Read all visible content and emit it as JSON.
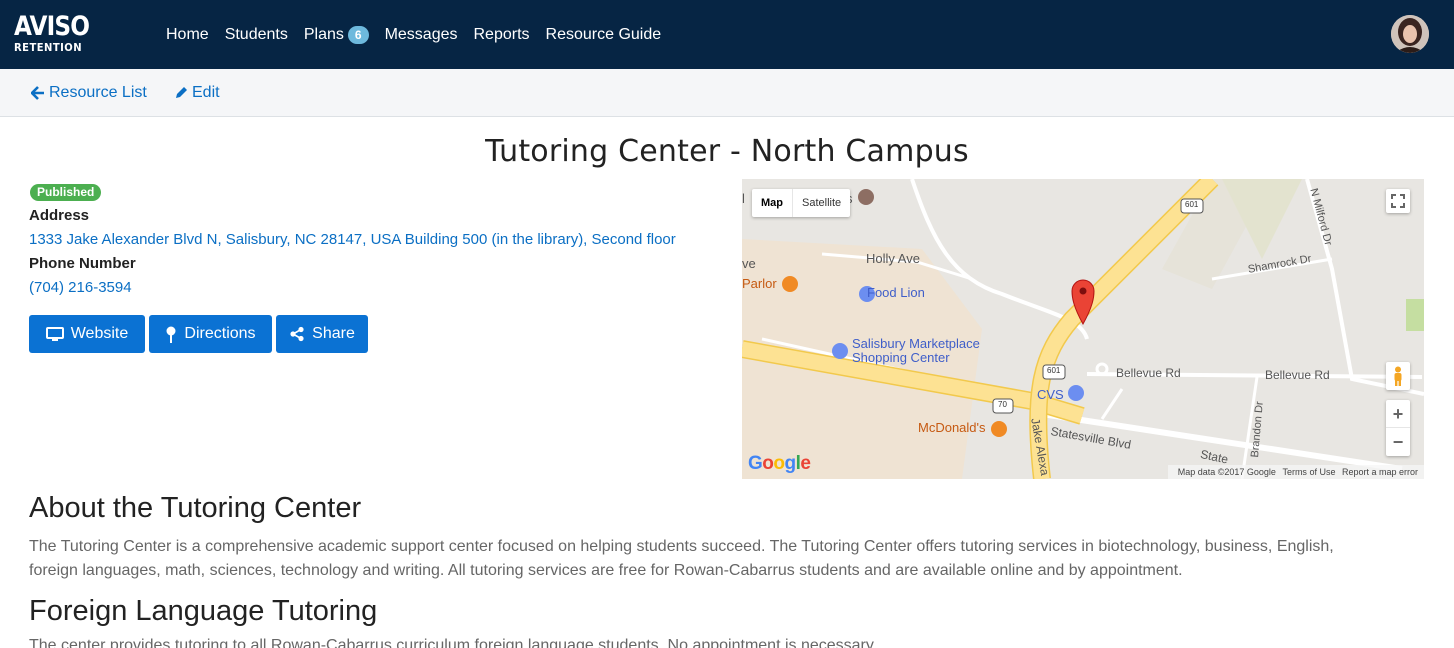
{
  "brand": {
    "name": "AVISO",
    "tagline": "RETENTION"
  },
  "nav": {
    "items": [
      {
        "label": "Home"
      },
      {
        "label": "Students"
      },
      {
        "label": "Plans",
        "badge": "6"
      },
      {
        "label": "Messages"
      },
      {
        "label": "Reports"
      },
      {
        "label": "Resource Guide"
      }
    ]
  },
  "toolbar": {
    "back_label": "Resource List",
    "edit_label": "Edit"
  },
  "resource": {
    "title": "Tutoring Center - North Campus",
    "status": "Published",
    "address_label": "Address",
    "address": "1333 Jake Alexander Blvd N, Salisbury, NC 28147, USA Building 500 (in the library), Second floor",
    "phone_label": "Phone Number",
    "phone": "(704) 216-3594",
    "buttons": {
      "website": "Website",
      "directions": "Directions",
      "share": "Share"
    }
  },
  "map": {
    "type_map": "Map",
    "type_satellite": "Satellite",
    "zoom_in": "+",
    "zoom_out": "−",
    "logo": "Google",
    "attribution": "Map data ©2017 Google",
    "terms": "Terms of Use",
    "report": "Report a map error",
    "labels": {
      "holly": "Holly Ave",
      "food_lion": "Food Lion",
      "parlor": "Parlor",
      "marketplace_1": "Salisbury Marketplace",
      "marketplace_2": "Shopping Center",
      "cvs": "CVS",
      "mcdonalds": "McDonald's",
      "bellevue_1": "Bellevue Rd",
      "bellevue_2": "Bellevue Rd",
      "statesville": "Statesville Blvd",
      "shamrock": "Shamrock Dr",
      "milford": "N Milford Dr",
      "brandon": "Brandon Dr",
      "jake": "Jake Alexa",
      "state": "State",
      "partial_l": "l",
      "partial_s": "s",
      "partial_ve": "ve",
      "route_601a": "601",
      "route_601b": "601",
      "route_70": "70"
    },
    "colors": {
      "major_road": "#fde293",
      "road_edge": "#f2c94c",
      "land": "#e8e6e2",
      "marker": "#ea4335"
    }
  },
  "content": {
    "about_heading": "About the Tutoring Center",
    "about_text": "The Tutoring Center is a comprehensive academic support center focused on helping students succeed. The Tutoring Center offers tutoring services in biotechnology, business, English, foreign languages, math, sciences, technology and writing. All tutoring services are free for Rowan-Cabarrus students and are available online and by appointment.",
    "foreign_heading": "Foreign Language Tutoring",
    "foreign_text": "The center provides tutoring to all Rowan-Cabarrus curriculum foreign language students. No appointment is necessary."
  },
  "colors": {
    "navbar": "#062544",
    "link": "#0b6fc4",
    "button": "#0b72d3",
    "published": "#4caf50",
    "badge": "#6db9dd"
  }
}
